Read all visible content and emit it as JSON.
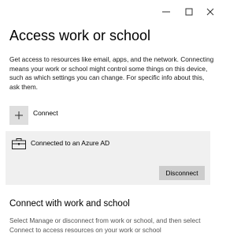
{
  "window": {
    "minimize_icon": "minimize-icon",
    "maximize_icon": "maximize-icon",
    "close_icon": "close-icon"
  },
  "page": {
    "title": "Access work or school",
    "description": "Get access to resources like email, apps, and the network. Connecting means your work or school might control some things on this device, such as which settings you can change. For specific info about this, ask them."
  },
  "connect": {
    "icon": "plus-icon",
    "label": "Connect"
  },
  "account": {
    "icon": "briefcase-icon",
    "label": "Connected to an Azure AD",
    "disconnect_label": "Disconnect"
  },
  "section": {
    "title": "Connect with work and school",
    "description": "Select Manage or disconnect from work or school, and then select Connect to access resources on your work or school"
  },
  "colors": {
    "panel_bg": "#f0f0f0",
    "button_bg": "#cccccc",
    "plus_bg": "#dedede"
  }
}
